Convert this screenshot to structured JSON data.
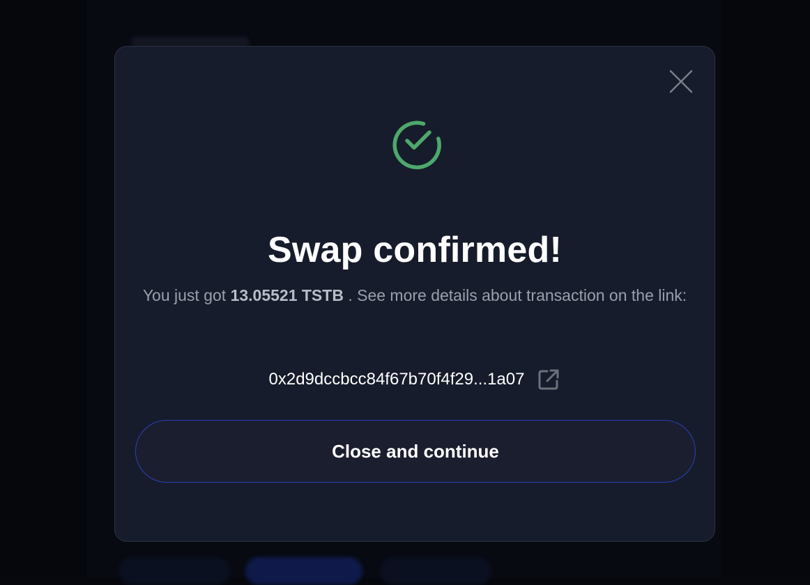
{
  "modal": {
    "close_icon": "close-icon",
    "success_icon": "check-circle-icon",
    "title": "Swap confirmed!",
    "message": {
      "prefix": "You just got ",
      "amount": "13.05521 TSTB",
      "suffix": " . See more details about transaction on the link:"
    },
    "tx_hash": "0x2d9dccbcc84f67b70f4f29...1a07",
    "external_link_icon": "external-link-icon",
    "continue_label": "Close and continue"
  },
  "colors": {
    "success": "#4ea86b",
    "modal_background": "#161c2b",
    "button_border": "#2d3fb8"
  }
}
